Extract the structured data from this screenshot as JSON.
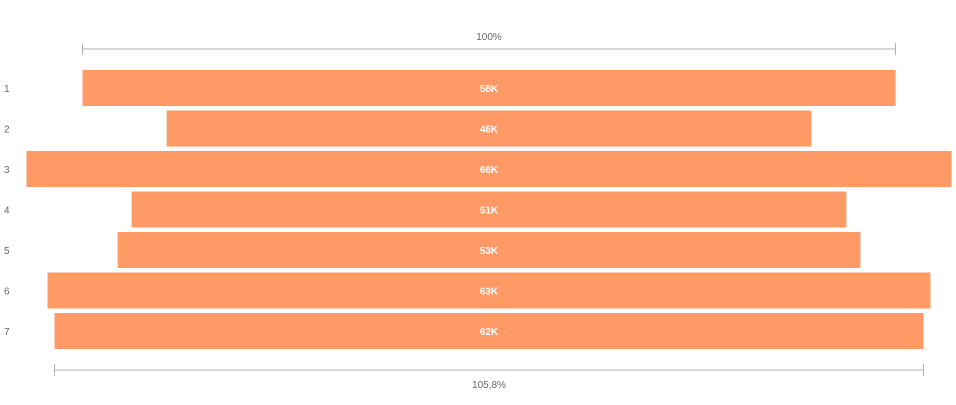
{
  "chart_data": {
    "type": "bar",
    "orientation": "horizontal-centered-funnel",
    "categories": [
      "1",
      "2",
      "3",
      "4",
      "5",
      "6",
      "7"
    ],
    "values": [
      58000,
      46000,
      66000,
      51000,
      53000,
      63000,
      62000
    ],
    "value_labels": [
      "58K",
      "46K",
      "66K",
      "51K",
      "53K",
      "63K",
      "62K"
    ],
    "top_reference": {
      "label": "100%"
    },
    "bottom_reference": {
      "label": "105,8%"
    },
    "grid": false,
    "legend": "none"
  },
  "colors": {
    "bar": "#FF9966",
    "bar_label": "#FFFFFF",
    "axis_text": "#666666",
    "reference_line": "#B0B0B0"
  }
}
